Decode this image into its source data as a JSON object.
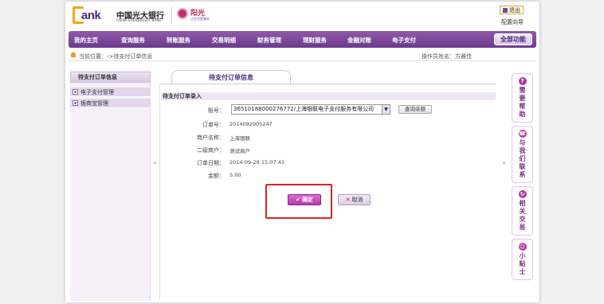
{
  "header": {
    "logo_text": "ank",
    "bank_name_cn": "中国光大银行",
    "bank_name_en": "CHINA EVERBRIGHT BANK",
    "brand_title": "阳光",
    "brand_subtitle": "让生活更美好",
    "exit_label": "退出",
    "help_link": "配置向导"
  },
  "nav": {
    "items": [
      "我的主页",
      "查询服务",
      "转账服务",
      "交易明细",
      "财务管理",
      "理财服务",
      "金融对账",
      "电子支付"
    ],
    "all_functions": "全部功能"
  },
  "breadcrumb": {
    "text": "当前位置：->待支付订单信息",
    "operator": "操作员姓名：方雅佳"
  },
  "sidebar": {
    "title": "待支付订单信息",
    "items": [
      "电子支付管理",
      "银商宝管理"
    ]
  },
  "main": {
    "tab_label": "待支付订单信息",
    "section_title": "待支付订单录入",
    "form": {
      "account_label": "账号：",
      "account_value": "36510188000276772/上海银联电子支付服务有限公司",
      "query_button": "查询余额",
      "order_no_label": "订单号：",
      "order_no_value": "2014092905247",
      "merchant_label": "商户名称：",
      "merchant_value": "上海银联",
      "sub_merchant_label": "二级商户：",
      "sub_merchant_value": "测试商户",
      "order_date_label": "订单日期：",
      "order_date_value": "2014-09-29 15:07:43",
      "amount_label": "金额：",
      "amount_value": "5.00"
    },
    "confirm_button": "确定",
    "cancel_button": "取消"
  },
  "right_bar": {
    "cards": [
      {
        "label": [
          "需",
          "要",
          "帮",
          "助"
        ]
      },
      {
        "label": [
          "与",
          "我",
          "们",
          "联",
          "系"
        ]
      },
      {
        "label": [
          "相",
          "关",
          "交",
          "易"
        ]
      },
      {
        "label": [
          "小",
          "贴",
          "士"
        ]
      }
    ]
  },
  "colors": {
    "brand_purple": "#6b3a8c",
    "accent_pink": "#b53aa8",
    "highlight_red": "#e02020"
  }
}
